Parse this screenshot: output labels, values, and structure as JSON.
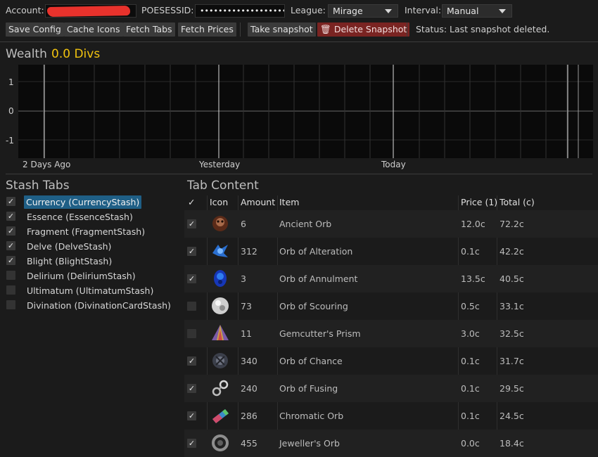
{
  "toolbar": {
    "account_label": "Account:",
    "poesessid_label": "POESESSID:",
    "poesessid_value": "••••••••••••••••••••••••••••",
    "league_label": "League:",
    "league_value": "Mirage",
    "interval_label": "Interval:",
    "interval_value": "Manual",
    "buttons": {
      "save_config": "Save Config",
      "cache_icons": "Cache Icons",
      "fetch_tabs": "Fetch Tabs",
      "fetch_prices": "Fetch Prices",
      "take_snapshot": "Take snapshot",
      "delete_snapshot": "Delete Snapshot"
    },
    "status": "Status: Last snapshot deleted."
  },
  "wealth": {
    "title": "Wealth",
    "value": "0.0 Divs",
    "y_ticks": [
      "1",
      "0",
      "-1"
    ],
    "x_ticks": [
      "2 Days Ago",
      "Yesterday",
      "Today"
    ]
  },
  "stash": {
    "title": "Stash Tabs",
    "items": [
      {
        "label": "Currency (CurrencyStash)",
        "checked": true,
        "selected": true
      },
      {
        "label": "Essence (EssenceStash)",
        "checked": true
      },
      {
        "label": "Fragment (FragmentStash)",
        "checked": true
      },
      {
        "label": "Delve (DelveStash)",
        "checked": true
      },
      {
        "label": "Blight (BlightStash)",
        "checked": true
      },
      {
        "label": "Delirium (DeliriumStash)",
        "checked": false
      },
      {
        "label": "Ultimatum (UltimatumStash)",
        "checked": false
      },
      {
        "label": "Divination (DivinationCardStash)",
        "checked": false
      }
    ]
  },
  "content": {
    "title": "Tab Content",
    "columns": {
      "check": "✓",
      "icon": "Icon",
      "amount": "Amount",
      "item": "Item",
      "price": "Price (1)",
      "total": "Total (c)"
    },
    "rows": [
      {
        "checked": true,
        "icon": "ancient-orb-icon",
        "amount": "6",
        "item": "Ancient Orb",
        "price": "12.0c",
        "total": "72.2c"
      },
      {
        "checked": true,
        "icon": "orb-of-alteration-icon",
        "amount": "312",
        "item": "Orb of Alteration",
        "price": "0.1c",
        "total": "42.2c"
      },
      {
        "checked": true,
        "icon": "orb-of-annulment-icon",
        "amount": "3",
        "item": "Orb of Annulment",
        "price": "13.5c",
        "total": "40.5c"
      },
      {
        "checked": false,
        "icon": "orb-of-scouring-icon",
        "amount": "73",
        "item": "Orb of Scouring",
        "price": "0.5c",
        "total": "33.1c"
      },
      {
        "checked": false,
        "icon": "gemcutters-prism-icon",
        "amount": "11",
        "item": "Gemcutter's Prism",
        "price": "3.0c",
        "total": "32.5c"
      },
      {
        "checked": true,
        "icon": "orb-of-chance-icon",
        "amount": "340",
        "item": "Orb of Chance",
        "price": "0.1c",
        "total": "31.7c"
      },
      {
        "checked": true,
        "icon": "orb-of-fusing-icon",
        "amount": "240",
        "item": "Orb of Fusing",
        "price": "0.1c",
        "total": "29.5c"
      },
      {
        "checked": true,
        "icon": "chromatic-orb-icon",
        "amount": "286",
        "item": "Chromatic Orb",
        "price": "0.1c",
        "total": "24.5c"
      },
      {
        "checked": true,
        "icon": "jewellers-orb-icon",
        "amount": "455",
        "item": "Jeweller's Orb",
        "price": "0.0c",
        "total": "18.4c"
      }
    ]
  },
  "colors": {
    "gold": "#f1c30f",
    "selection": "#1f5f86",
    "danger": "#7a2422"
  }
}
